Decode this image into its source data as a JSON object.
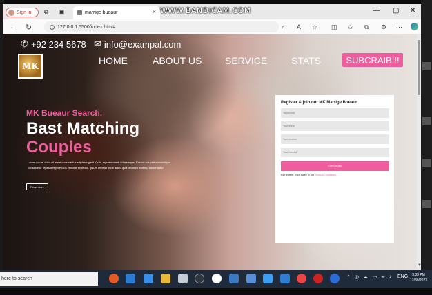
{
  "browser": {
    "profile_label": "Sign in",
    "tab_title": "marrige bueaur",
    "tab_close": "×",
    "new_tab": "+",
    "watermark": "WWW.BANDICAM.COM",
    "url": "127.0.0.1:5500/index.html#",
    "win_minimize": "—",
    "win_maximize": "▢",
    "win_close": "✕"
  },
  "site": {
    "phone": "+92 234 5678",
    "email": "info@exampal.com",
    "logo_text": "MK",
    "nav": {
      "home": "HOME",
      "about": "ABOUT US",
      "service": "SERVICE",
      "stats": "STATS",
      "subscribe": "SUBCRAIB!!!"
    },
    "hero": {
      "kicker": "MK Bueaur Search.",
      "title_line1": "Bast Matching",
      "title_line2": "Couples",
      "text": "Lorem ipsum dolor sit amet consectetur adipisicing elit. Quis, reprehenderit doloremque. Exercit voluptatum similique consectetur repellat repellendus veritatis expedita. Ipsum impedit unde animi quia laborum mollitia, labore dolor!",
      "read_more": "Read more"
    },
    "form": {
      "title": "Register & join our MK Marrige Bueaur",
      "placeholders": [
        "Your name",
        "Your email",
        "Your number",
        "Your interest"
      ],
      "submit": "Get Started",
      "terms_prefix": "By Register, Your agree to our",
      "terms_link": "Terms & Conditions"
    }
  },
  "taskbar": {
    "search_text": "here to search",
    "lang": "ENG",
    "time": "3:33 PM",
    "date": "12/30/2023"
  },
  "colors": {
    "accent_pink": "#ec5f9c",
    "taskbar": "#1f2a3a"
  }
}
